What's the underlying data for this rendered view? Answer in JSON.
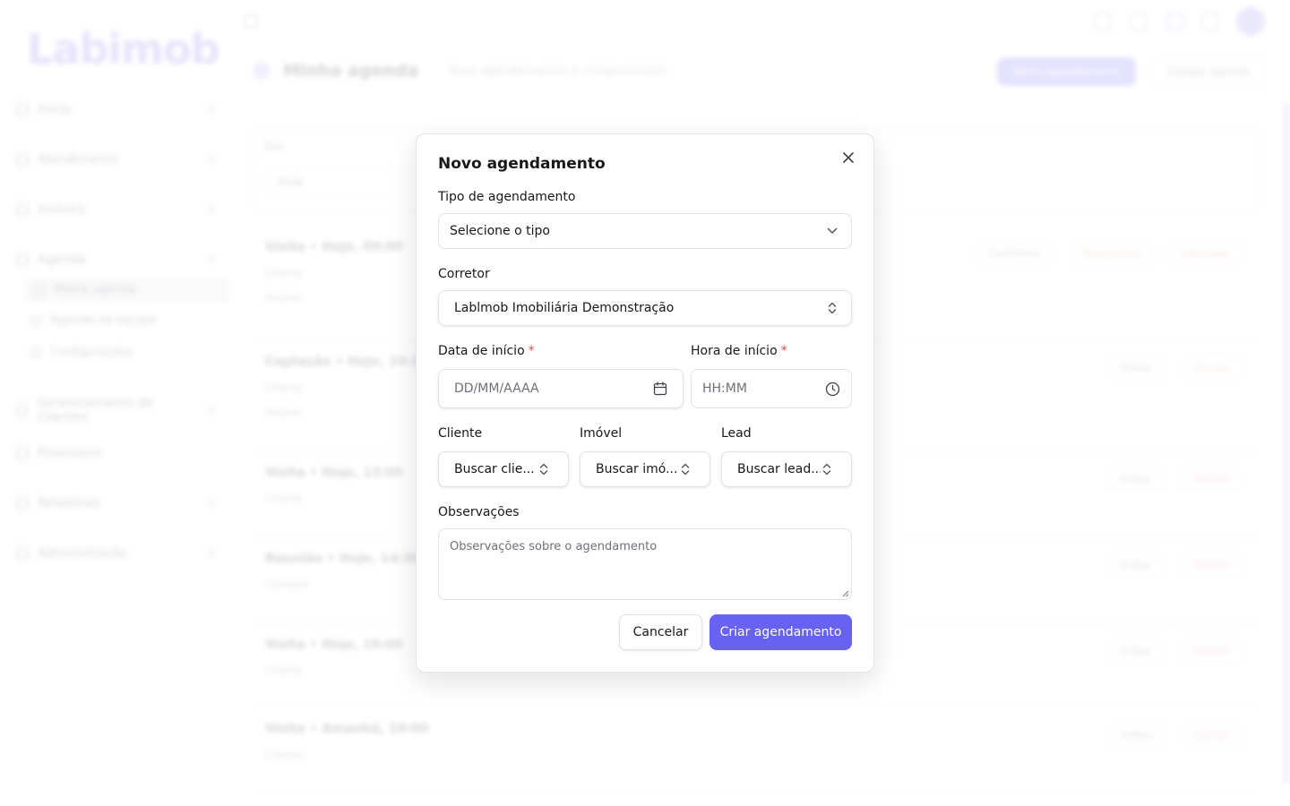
{
  "background": {
    "logo": "Labimob",
    "logo_sub": "",
    "sidebar": [
      {
        "label": "Início"
      },
      {
        "label": "Atendimento"
      },
      {
        "label": "Imóveis"
      },
      {
        "label": "Agenda"
      },
      {
        "label": "Gerenciamento de Clientes"
      },
      {
        "label": "Financeiro"
      },
      {
        "label": "Relatórios"
      },
      {
        "label": "Administração"
      }
    ],
    "sidebar_sub": [
      {
        "label": "Minha agenda"
      },
      {
        "label": "Agenda da equipe"
      },
      {
        "label": "Configurações"
      }
    ],
    "page_title": "Minha agenda",
    "page_subtitle": "Seus agendamentos e compromissos",
    "new_button": "Novo agendamento",
    "secondary_button": "Google Agenda",
    "filter_label": "Dia",
    "filter_value": "Hoje",
    "rows": [
      {
        "title": "Visita • Hoje, 09:00",
        "meta": "Cliente",
        "meta2": "Imóvel",
        "actions": [
          "Confirmar",
          "Reagendar",
          "Cancelar"
        ]
      },
      {
        "title": "Captação • Hoje, 10:30",
        "meta": "Cliente",
        "meta2": "Imóvel",
        "actions": [
          "Editar",
          "Excluir"
        ]
      },
      {
        "title": "Visita • Hoje, 13:00",
        "meta": "Cliente",
        "meta2": "",
        "actions": [
          "Editar",
          "Excluir"
        ]
      },
      {
        "title": "Reunião • Hoje, 14:30",
        "meta": "Corretor",
        "meta2": "",
        "actions": [
          "Editar",
          "Excluir"
        ]
      },
      {
        "title": "Visita • Hoje, 16:00",
        "meta": "Cliente",
        "meta2": "",
        "actions": [
          "Editar",
          "Excluir"
        ]
      },
      {
        "title": "Visita • Amanhã, 10:00",
        "meta": "Cliente",
        "meta2": "",
        "actions": [
          "Editar",
          "Excluir"
        ]
      }
    ]
  },
  "modal": {
    "title": "Novo agendamento",
    "close_icon": "close-icon",
    "tipo": {
      "label": "Tipo de agendamento",
      "value": "Selecione o tipo"
    },
    "corretor": {
      "label": "Corretor",
      "value": "Lablmob Imobiliária Demonstração"
    },
    "data_inicio": {
      "label": "Data de início",
      "required": "*",
      "placeholder": "DD/MM/AAAA"
    },
    "hora_inicio": {
      "label": "Hora de início",
      "required": "*",
      "placeholder": "HH:MM"
    },
    "cliente": {
      "label": "Cliente",
      "value": "Buscar clie..."
    },
    "imovel": {
      "label": "Imóvel",
      "value": "Buscar imó..."
    },
    "lead": {
      "label": "Lead",
      "value": "Buscar lead..."
    },
    "observacoes": {
      "label": "Observações",
      "placeholder": "Observações sobre o agendamento"
    },
    "cancel_label": "Cancelar",
    "submit_label": "Criar agendamento",
    "accent": "#6762f1"
  }
}
